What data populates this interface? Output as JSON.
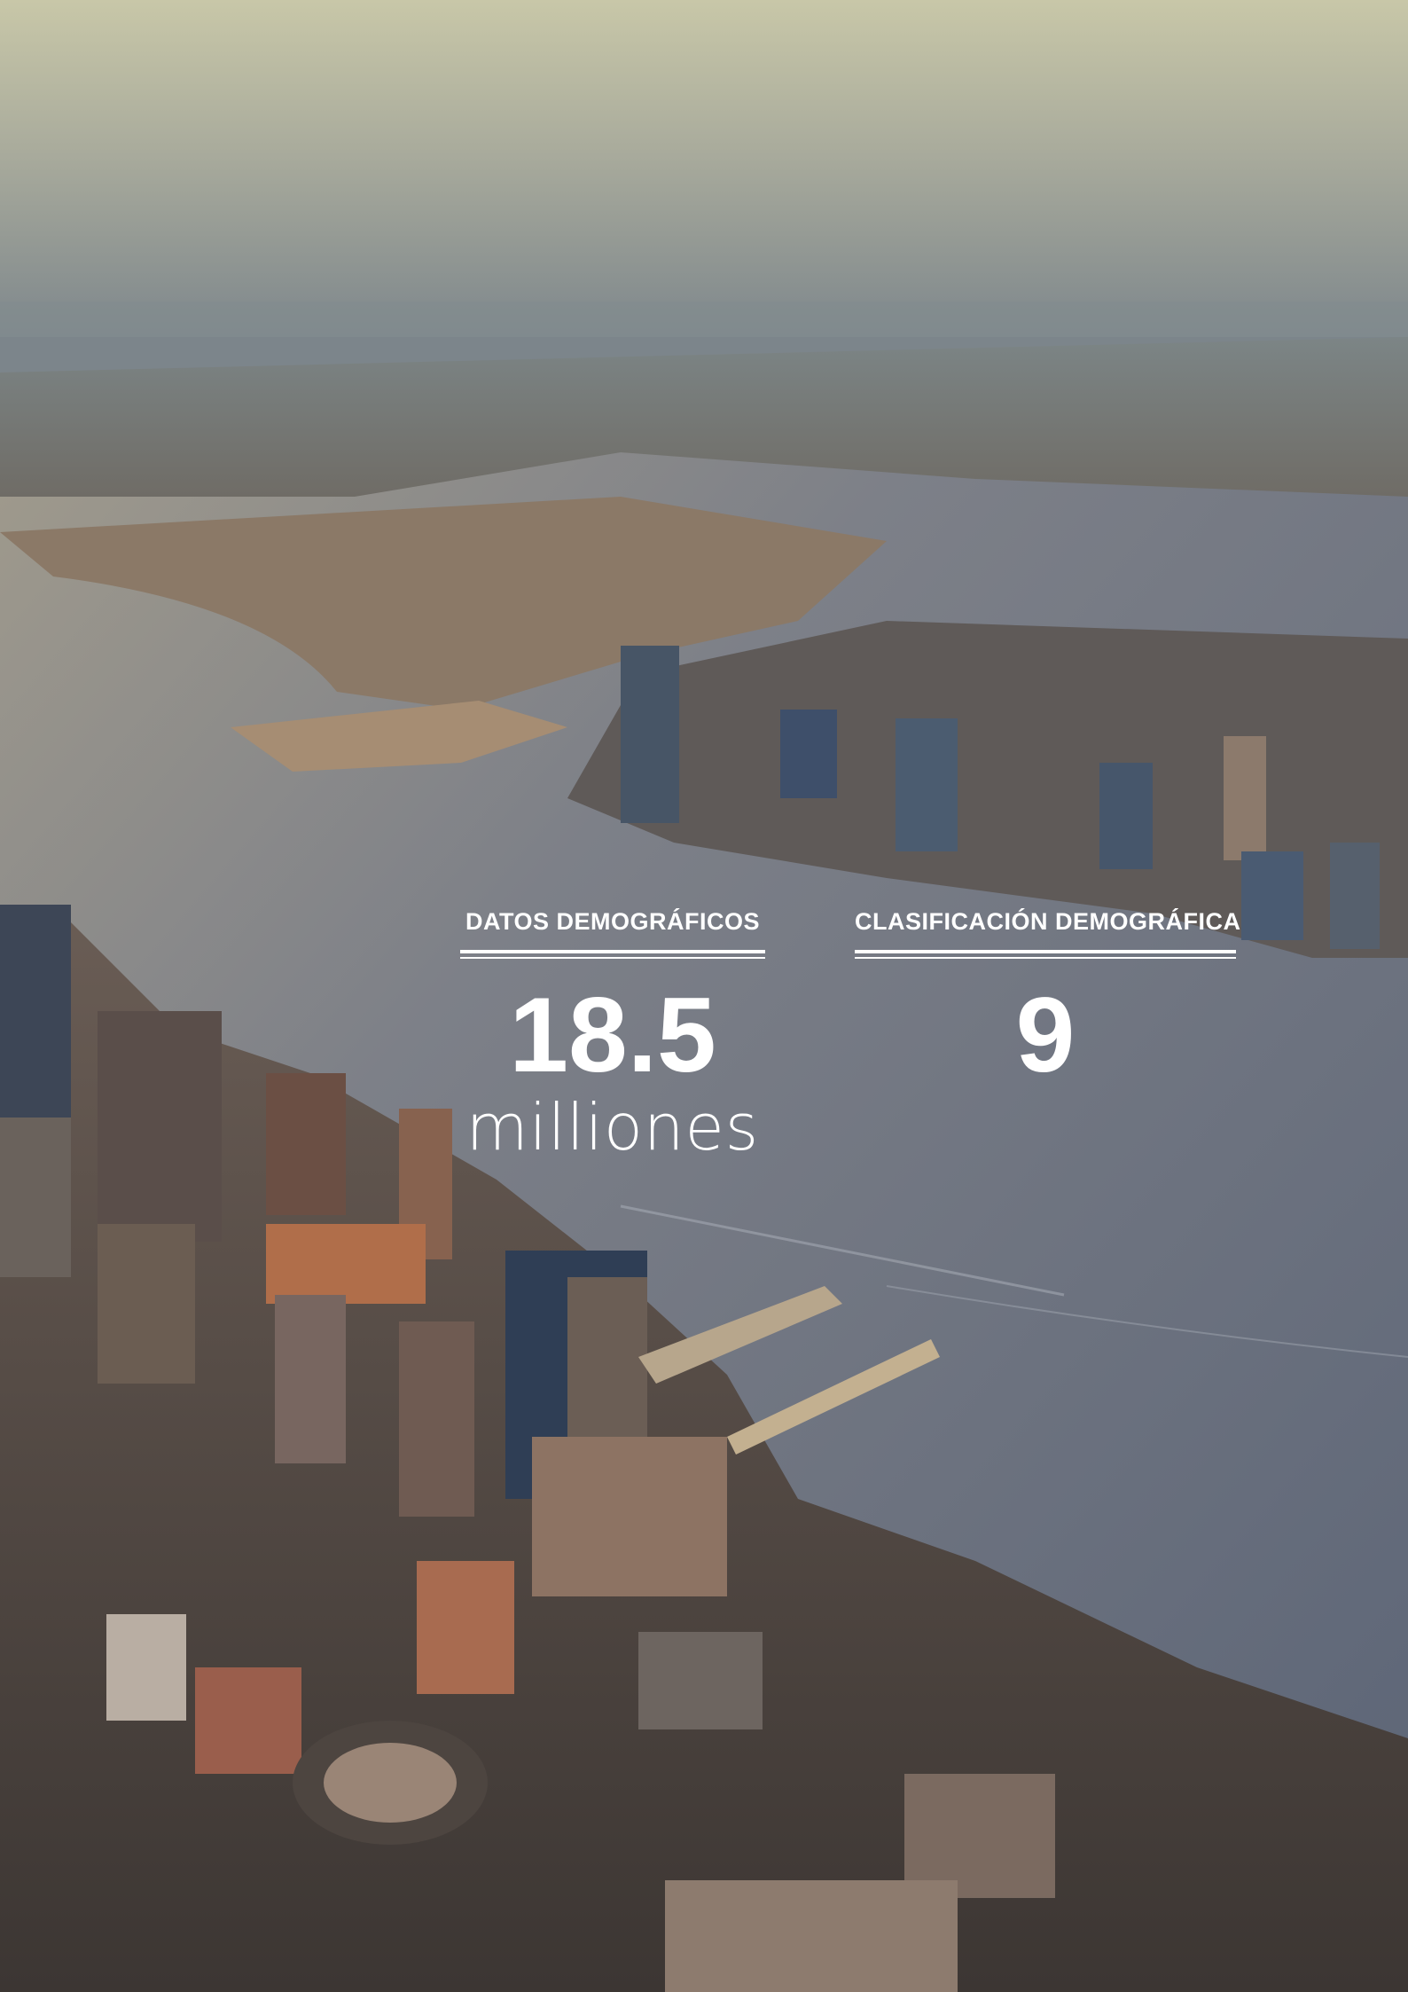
{
  "stats": [
    {
      "label": "DATOS DEMOGRÁFICOS",
      "value": "18.5",
      "unit": "milliones"
    },
    {
      "label": "CLASIFICACIÓN DEMOGRÁFICA",
      "value": "9",
      "unit": ""
    }
  ],
  "colors": {
    "text": "#ffffff",
    "sky": "#c9c6a9",
    "water": "#6e7685",
    "land": "#8a7e73"
  }
}
